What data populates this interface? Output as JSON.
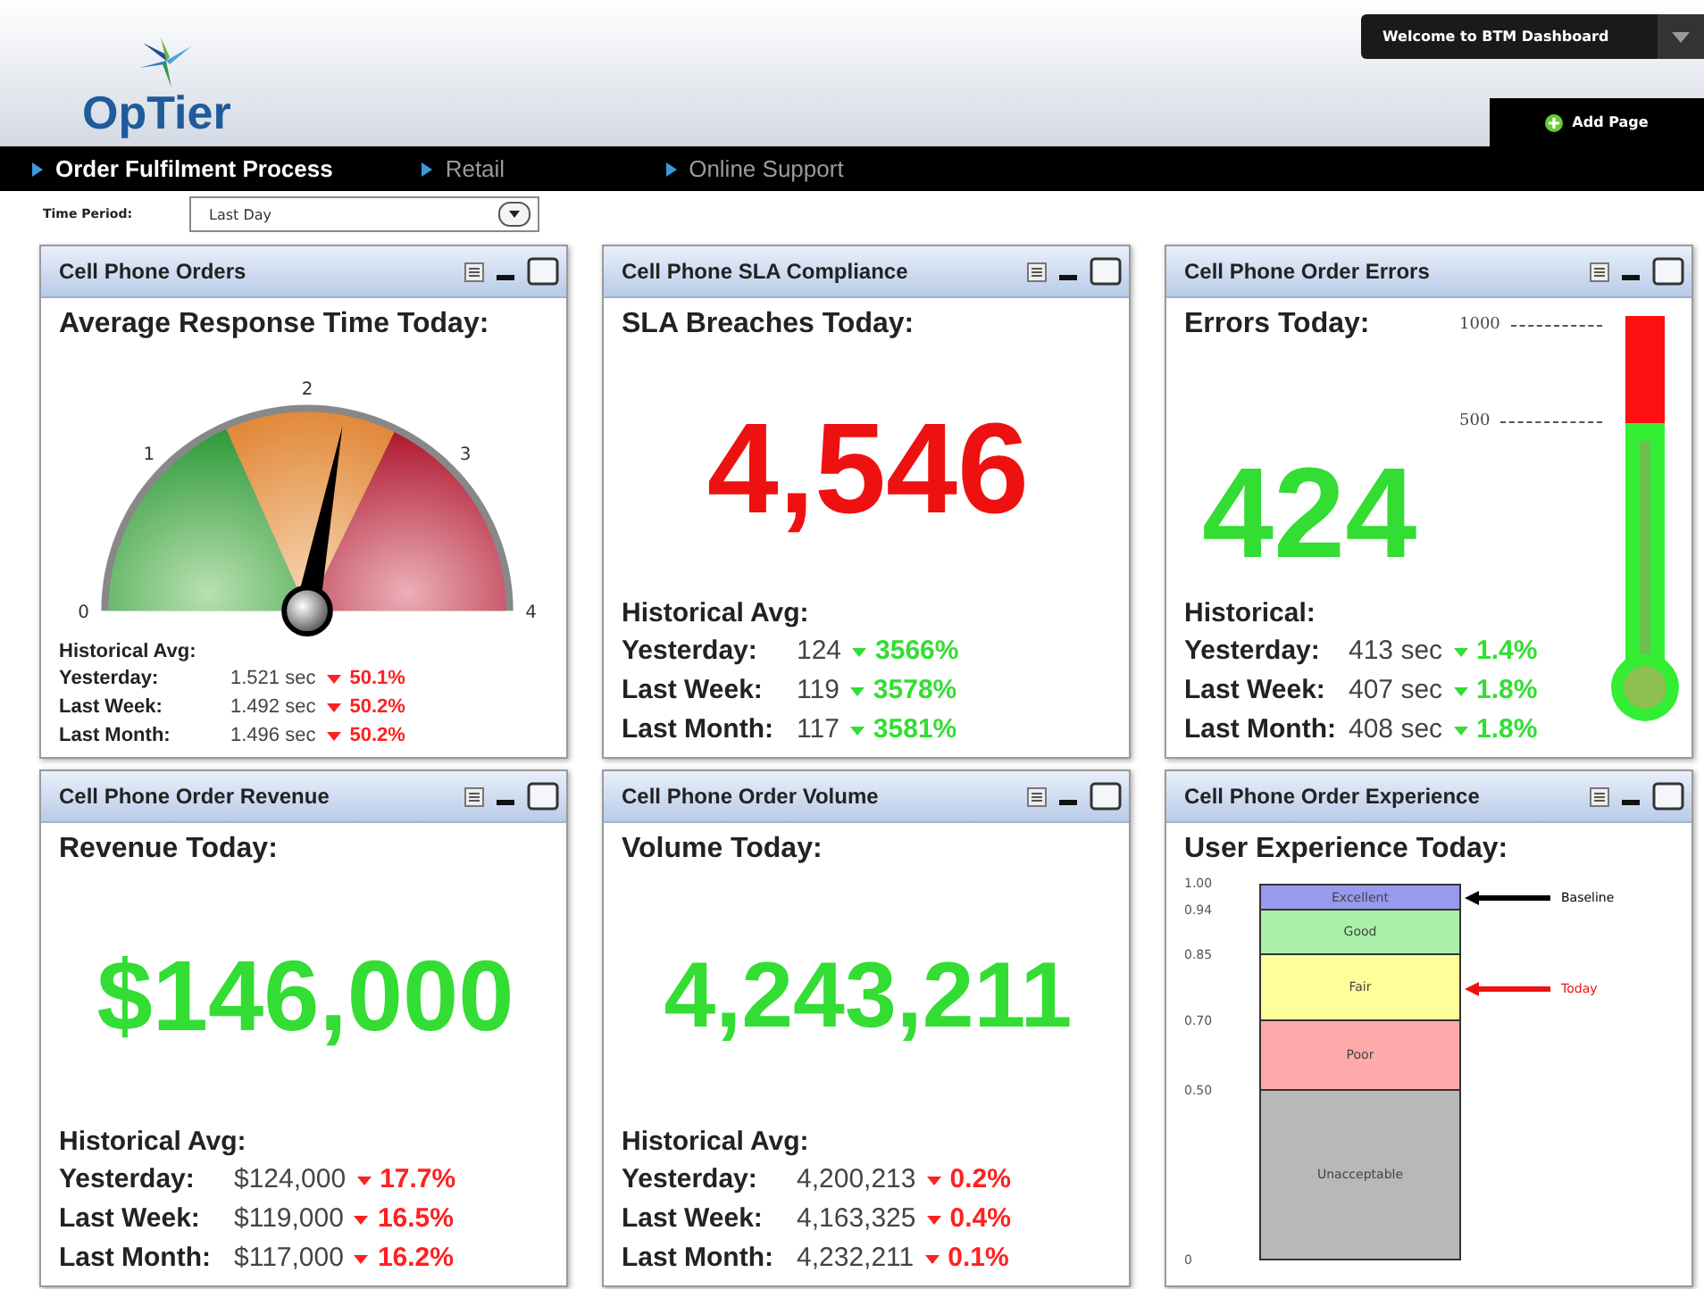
{
  "header": {
    "logo": "OpTier",
    "welcome": "Welcome to BTM Dashboard",
    "add_page": "Add Page"
  },
  "tabs": [
    {
      "label": "Order Fulfilment Process",
      "selected": true
    },
    {
      "label": "Retail",
      "selected": false
    },
    {
      "label": "Online Support",
      "selected": false
    }
  ],
  "filter": {
    "label": "Time Period:",
    "value": "Last Day"
  },
  "panels": [
    {
      "kind": "gauge",
      "title": "Cell Phone Orders",
      "heading": "Average Response Time Today:",
      "gauge": {
        "labels": [
          "0",
          "1",
          "2",
          "3",
          "4"
        ],
        "level": 0.56
      },
      "history_title": "Historical Avg:",
      "history": [
        {
          "label": "Yesterday:",
          "value": "1.521 sec",
          "change": "50.1%",
          "color": "#ff2020"
        },
        {
          "label": "Last Week:",
          "value": "1.492 sec",
          "change": "50.2%",
          "color": "#ff2020"
        },
        {
          "label": "Last Month:",
          "value": "1.496 sec",
          "change": "50.2%",
          "color": "#ff2020"
        }
      ]
    },
    {
      "kind": "number",
      "title": "Cell Phone SLA Compliance",
      "heading": "SLA Breaches Today:",
      "value": "4,546",
      "color": "#ee1111",
      "history_title": "Historical Avg:",
      "history": [
        {
          "label": "Yesterday:",
          "value": "124",
          "change": "3566%",
          "color": "#33dd33"
        },
        {
          "label": "Last Week:",
          "value": "119",
          "change": "3578%",
          "color": "#33dd33"
        },
        {
          "label": "Last Month:",
          "value": "117",
          "change": "3581%",
          "color": "#33dd33"
        }
      ]
    },
    {
      "kind": "thermometer",
      "title": "Cell Phone Order Errors",
      "heading": "Errors Today:",
      "scale": [
        "1000",
        "500"
      ],
      "value": "424",
      "color": "#33dd33",
      "history_title": "Historical:",
      "history": [
        {
          "label": "Yesterday:",
          "value": "413 sec",
          "change": "1.4%",
          "color": "#33dd33"
        },
        {
          "label": "Last Week:",
          "value": "407 sec",
          "change": "1.8%",
          "color": "#33dd33"
        },
        {
          "label": "Last Month:",
          "value": "408 sec",
          "change": "1.8%",
          "color": "#33dd33"
        }
      ]
    },
    {
      "kind": "number",
      "title": "Cell Phone Order Revenue",
      "heading": "Revenue Today:",
      "value": "$146,000",
      "color": "#33dd33",
      "history_title": "Historical Avg:",
      "history": [
        {
          "label": "Yesterday:",
          "value": "$124,000",
          "change": "17.7%",
          "color": "#ff2020"
        },
        {
          "label": "Last Week:",
          "value": "$119,000",
          "change": "16.5%",
          "color": "#ff2020"
        },
        {
          "label": "Last Month:",
          "value": "$117,000",
          "change": "16.2%",
          "color": "#ff2020"
        }
      ]
    },
    {
      "kind": "number",
      "title": "Cell Phone Order Volume",
      "heading": "Volume Today:",
      "value": "4,243,211",
      "color": "#33dd33",
      "history_title": "Historical Avg:",
      "history": [
        {
          "label": "Yesterday:",
          "value": "4,200,213",
          "change": "0.2%",
          "color": "#ff2020"
        },
        {
          "label": "Last Week:",
          "value": "4,163,325",
          "change": "0.4%",
          "color": "#ff2020"
        },
        {
          "label": "Last Month:",
          "value": "4,232,211",
          "change": "0.1%",
          "color": "#ff2020"
        }
      ]
    },
    {
      "kind": "experience",
      "title": "Cell Phone Order Experience",
      "heading": "User Experience Today:",
      "bottom_tick": "0",
      "bands": [
        {
          "label": "Excellent",
          "tick": "1.00",
          "color": "#9999ee",
          "marker": {
            "label": "Baseline",
            "color": "#000000"
          }
        },
        {
          "label": "Good",
          "tick": "0.94",
          "color": "#aaf0aa"
        },
        {
          "label": "Fair",
          "tick": "0.85",
          "color": "#ffff99",
          "marker": {
            "label": "Today",
            "color": "#ee1111"
          }
        },
        {
          "label": "Poor",
          "tick": "0.70",
          "color": "#ffaaaa"
        },
        {
          "label": "Unacceptable",
          "tick": "0.50",
          "color": "#b8b8b8"
        }
      ]
    }
  ]
}
